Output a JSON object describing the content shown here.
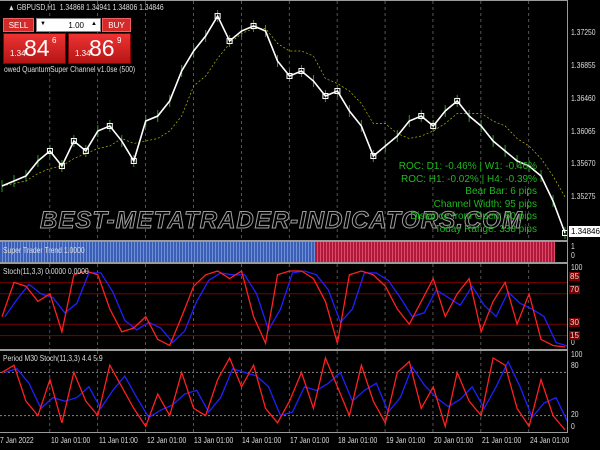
{
  "header": {
    "symbol": "GBPUSD,H1",
    "ohlc": "1.34868 1.34941 1.34806 1.34846"
  },
  "trade_panel": {
    "sell_label": "SELL",
    "buy_label": "BUY",
    "lot": "1.00",
    "sell_prefix": "1.34",
    "sell_big": "84",
    "sell_small": "6",
    "buy_prefix": "1.34",
    "buy_big": "86",
    "buy_small": "9",
    "down_arrow": "▼",
    "up_arrow": "▲"
  },
  "indicator_label": "owed QuantumSuper Channel v1.0se (500)",
  "watermark": "BEST-METATRADER-INDICATORS.COM",
  "info": [
    "ROC: D1: -0.46% | W1: -0.46%",
    "ROC: H1: -0.02% | H4: -0.39%",
    "Bear Bar: 6 pips",
    "Channel Width: 95 pips",
    "Distance from Open: 60 pips",
    "Today Range:  338 pips"
  ],
  "price_axis": [
    "1.37250",
    "1.36855",
    "1.36460",
    "1.36065",
    "1.35670",
    "1.35275"
  ],
  "current_price": "1.34846",
  "price_series": [
    1.35414,
    1.35474,
    1.35535,
    1.35716,
    1.35837,
    1.35655,
    1.35957,
    1.35837,
    1.36078,
    1.36139,
    1.35957,
    1.35716,
    1.36199,
    1.36259,
    1.36441,
    1.36803,
    1.37045,
    1.37226,
    1.37467,
    1.37165,
    1.37286,
    1.37347,
    1.37286,
    1.36924,
    1.36743,
    1.36803,
    1.36682,
    1.36501,
    1.36561,
    1.3632,
    1.36139,
    1.35776,
    1.35897,
    1.36018,
    1.36199,
    1.36259,
    1.36139,
    1.3632,
    1.36441,
    1.36259,
    1.36139,
    1.35957,
    1.35837,
    1.35716,
    1.35655,
    1.35535,
    1.35233,
    1.34846
  ],
  "trend_panel": {
    "label": "Super Trader Trend 1.0000",
    "axis": [
      "1",
      "0"
    ],
    "up_color": "#3b5fb5",
    "down_color": "#b01a3a"
  },
  "stoch_panel": {
    "label": "Stoch(11,3,3) 0.0000 0.0000",
    "axis": [
      "100",
      "0"
    ],
    "levels": [
      "85",
      "70",
      "30",
      "15"
    ],
    "values": [
      40,
      85,
      80,
      60,
      70,
      20,
      95,
      100,
      95,
      50,
      20,
      25,
      40,
      10,
      2,
      40,
      80,
      95,
      100,
      90,
      100,
      40,
      5,
      95,
      100,
      100,
      90,
      60,
      5,
      95,
      100,
      95,
      80,
      50,
      30,
      60,
      90,
      40,
      70,
      90,
      20,
      60,
      85,
      30,
      70,
      10,
      2,
      0
    ]
  },
  "m30_panel": {
    "label": "Period M30 Stoch(11,3,3) 4.4 5.9",
    "axis": [
      "100",
      "80",
      "20",
      "0"
    ],
    "values": [
      80,
      90,
      40,
      20,
      70,
      10,
      80,
      40,
      20,
      90,
      60,
      30,
      5,
      50,
      20,
      80,
      30,
      20,
      70,
      100,
      60,
      90,
      30,
      10,
      40,
      80,
      30,
      100,
      60,
      20,
      90,
      40,
      10,
      80,
      95,
      30,
      60,
      5,
      80,
      40,
      20,
      100,
      90,
      30,
      5,
      70,
      20,
      0
    ]
  },
  "time_axis": [
    "7 Jan 2022",
    "10 Jan 01:00",
    "11 Jan 01:00",
    "12 Jan 01:00",
    "13 Jan 01:00",
    "14 Jan 01:00",
    "17 Jan 01:00",
    "18 Jan 01:00",
    "19 Jan 01:00",
    "20 Jan 01:00",
    "21 Jan 01:00",
    "24 Jan 01:00"
  ],
  "colors": {
    "main": "#ff2020",
    "signal": "#2020ff",
    "channel_upper": "#e00000",
    "channel_lower": "#1c8c1c",
    "price": "#ffffff",
    "info": "#1fb81f"
  }
}
